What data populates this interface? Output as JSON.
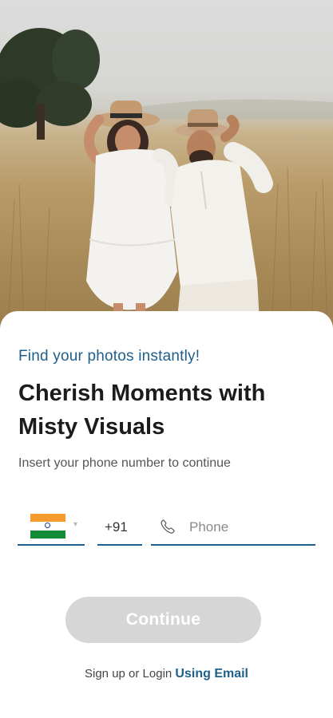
{
  "hero": {
    "image_name": "couple-in-field-photo"
  },
  "login": {
    "tagline": "Find your photos instantly!",
    "headline": "Cherish Moments with Misty Visuals",
    "subtitle": "Insert your phone number to continue",
    "country": {
      "flag": "india-flag",
      "caret_icon": "▾",
      "dial_code": "+91"
    },
    "phone": {
      "icon": "phone-icon",
      "placeholder": "Phone",
      "value": ""
    },
    "continue_label": "Continue",
    "signup_prefix": "Sign up or Login",
    "signup_link": "Using Email"
  },
  "colors": {
    "accent": "#1f5f8b",
    "button_disabled": "#d6d6d6",
    "flag_saffron": "#f59a2c",
    "flag_green": "#138a36"
  }
}
